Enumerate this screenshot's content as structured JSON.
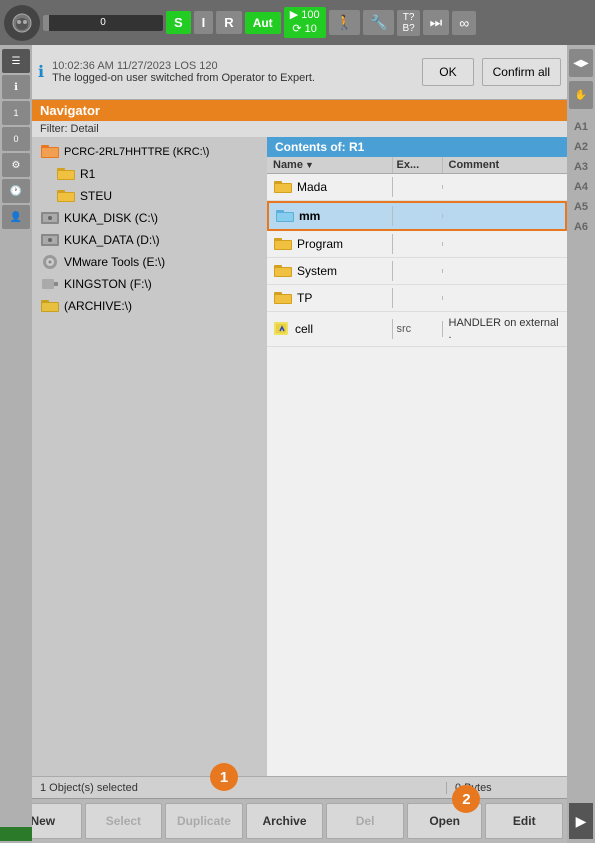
{
  "topbar": {
    "progress_value": "0",
    "btn_s": "S",
    "btn_i": "I",
    "btn_r": "R",
    "btn_aut": "Aut",
    "speed_top": "▶ 100",
    "speed_bot": "⟳ 10",
    "walk_icon": "🚶",
    "wrench_icon": "🔧",
    "t_btn": "T?\nB?",
    "skip_icon": "⏭",
    "inf_icon": "∞"
  },
  "infobar": {
    "time": "10:02:36 AM 11/27/2023 LOS 120",
    "message": "The logged-on user switched from Operator to Expert.",
    "btn_ok": "OK",
    "btn_confirm": "Confirm all"
  },
  "navigator": {
    "title": "Navigator",
    "filter": "Filter: Detail",
    "contents_label": "Contents of: R1",
    "columns": {
      "name": "Name",
      "ext": "Ex...",
      "comment": "Comment"
    },
    "tree": [
      {
        "id": "pcrc",
        "label": "PCRC-2RL7HHTTRE (KRC:\\)",
        "type": "robot",
        "indent": 0
      },
      {
        "id": "r1",
        "label": "R1",
        "type": "folder",
        "indent": 1
      },
      {
        "id": "steu",
        "label": "STEU",
        "type": "folder",
        "indent": 1
      },
      {
        "id": "kuka_disk",
        "label": "KUKA_DISK (C:\\)",
        "type": "drive",
        "indent": 0
      },
      {
        "id": "kuka_data",
        "label": "KUKA_DATA (D:\\)",
        "type": "drive",
        "indent": 0
      },
      {
        "id": "vmware",
        "label": "VMware Tools (E:\\)",
        "type": "cdrom",
        "indent": 0
      },
      {
        "id": "kingston",
        "label": "KINGSTON (F:\\)",
        "type": "usb",
        "indent": 0
      },
      {
        "id": "archive",
        "label": "(ARCHIVE:\\)",
        "type": "archive",
        "indent": 0
      }
    ],
    "contents": [
      {
        "id": "mada",
        "name": "Mada",
        "ext": "",
        "comment": "",
        "type": "folder",
        "selected": false
      },
      {
        "id": "mm",
        "name": "mm",
        "ext": "",
        "comment": "",
        "type": "folder",
        "selected": true
      },
      {
        "id": "program",
        "name": "Program",
        "ext": "",
        "comment": "",
        "type": "folder",
        "selected": false
      },
      {
        "id": "system",
        "name": "System",
        "ext": "",
        "comment": "",
        "type": "folder",
        "selected": false
      },
      {
        "id": "tp",
        "name": "TP",
        "ext": "",
        "comment": "",
        "type": "folder",
        "selected": false
      },
      {
        "id": "cell",
        "name": "cell",
        "ext": "src",
        "comment": "HANDLER on external .",
        "type": "file",
        "selected": false
      }
    ]
  },
  "statusbar": {
    "left": "1 Object(s) selected",
    "right": "0 Bytes"
  },
  "toolbar": {
    "new": "New",
    "select": "Select",
    "duplicate": "Duplicate",
    "archive": "Archive",
    "delete": "Del",
    "open": "Open",
    "edit": "Edit"
  },
  "right_sidebar": {
    "labels": [
      "A1",
      "A2",
      "A3",
      "A4",
      "A5",
      "A6"
    ]
  },
  "badges": {
    "badge1": "1",
    "badge2": "2"
  }
}
